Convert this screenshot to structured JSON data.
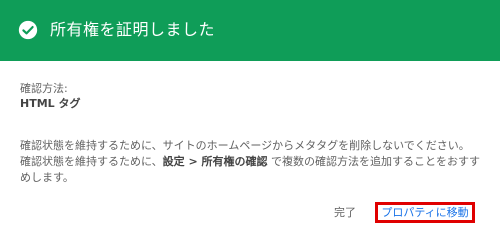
{
  "header": {
    "title": "所有権を証明しました",
    "icon": "check-circle-icon",
    "background_color": "#0f9d58"
  },
  "verification": {
    "method_label": "確認方法:",
    "method_value": "HTML タグ"
  },
  "description": {
    "part1": "確認状態を維持するために、サイトのホームページからメタタグを削除しないでください。 確認状態を維持するために、",
    "bold": "設定 > 所有権の確認",
    "part2": " で複数の確認方法を追加することをおすすめします。"
  },
  "actions": {
    "done_label": "完了",
    "goto_property_label": "プロパティに移動",
    "highlight_color": "#e00000",
    "link_color": "#1a73e8"
  }
}
